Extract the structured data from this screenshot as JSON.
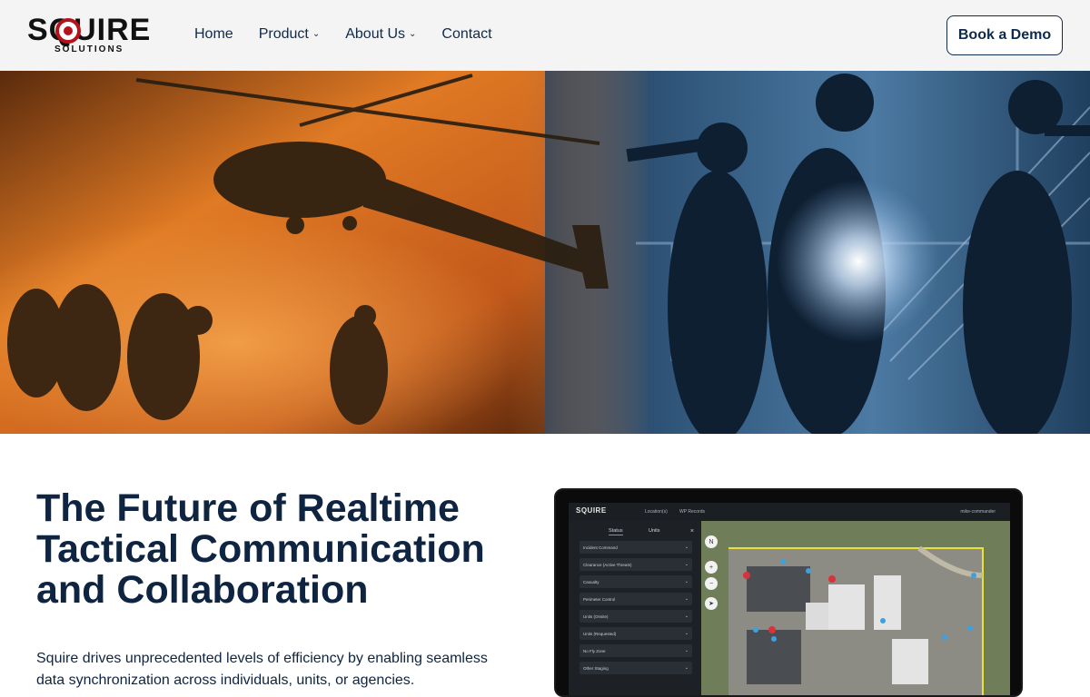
{
  "header": {
    "logo_word": "SQUIRE",
    "logo_sub": "SOLUTIONS",
    "nav": [
      {
        "label": "Home",
        "has_dropdown": false
      },
      {
        "label": "Product",
        "has_dropdown": true
      },
      {
        "label": "About Us",
        "has_dropdown": true
      },
      {
        "label": "Contact",
        "has_dropdown": false
      }
    ],
    "cta_label": "Book a Demo"
  },
  "hero": {
    "image": "Helicopter and soldiers in orange dust on the left, tactical team silhouettes in blue light on the right"
  },
  "main": {
    "headline": "The Future of Realtime Tactical Communication and Collaboration",
    "body": "Squire drives unprecedented levels of efficiency by enabling seamless data synchronization across individuals, units, or agencies."
  },
  "app_preview": {
    "logo": "SQUIRE",
    "tabs": [
      "Location(s)",
      "WP Records"
    ],
    "user": "mike-commander",
    "side_tabs": [
      "Status",
      "Units"
    ],
    "side_items": [
      "Incident Command",
      "Clearance (Active Threats)",
      "Casualty",
      "Perimeter Control",
      "Units (Onsite)",
      "Units (Requested)",
      "No Fly Zone",
      "Other Staging"
    ]
  },
  "colors": {
    "navy": "#0e2440",
    "brand_red": "#b5121b",
    "header_bg": "#f4f4f4"
  }
}
